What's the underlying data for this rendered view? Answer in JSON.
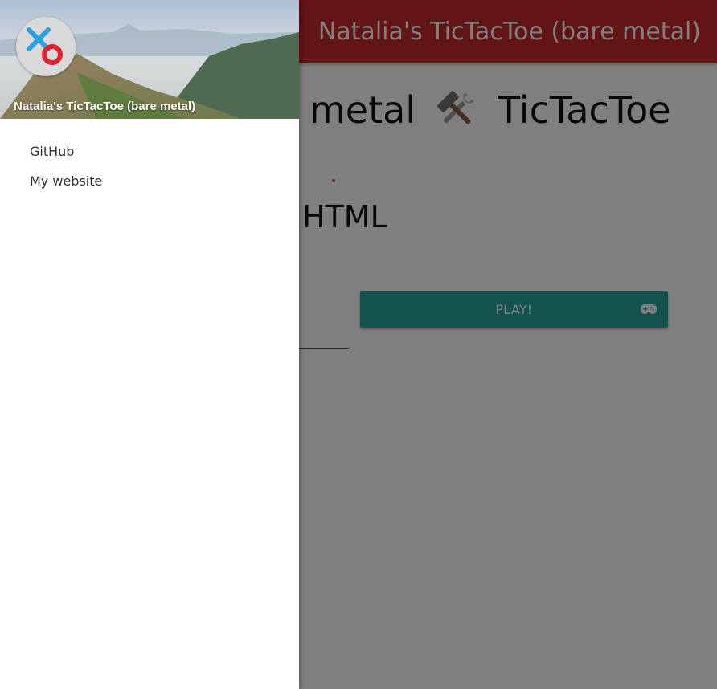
{
  "appbar": {
    "title": "Natalia's TicTacToe (bare metal)"
  },
  "main": {
    "heading_left": "metal",
    "heading_icon": "hammer-and-wrench-icon",
    "heading_right": "TicTacToe",
    "subheading": "HTML",
    "play_button": {
      "label": "PLAY!",
      "icon": "gamepad-icon"
    }
  },
  "drawer": {
    "app_name": "Natalia's TicTacToe (bare metal)",
    "avatar_icon": "tictactoe-xo-logo-icon",
    "nav_items": [
      {
        "label": "GitHub"
      },
      {
        "label": "My website"
      }
    ]
  },
  "colors": {
    "appbar": "#c62828",
    "play_button": "#26a69a",
    "scrim": "rgba(0,0,0,0.5)",
    "drawer": "#ffffff"
  }
}
